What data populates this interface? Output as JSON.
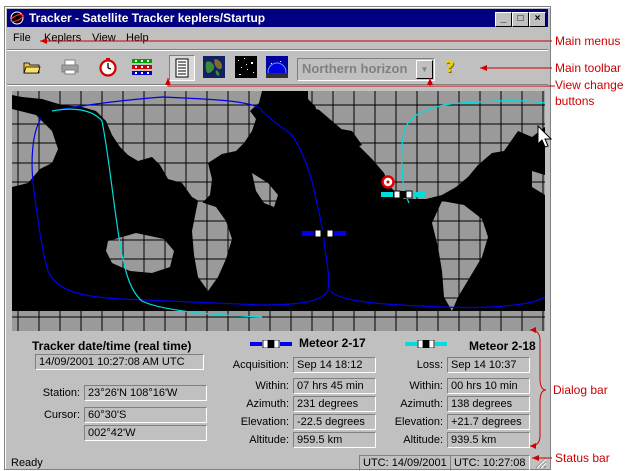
{
  "window": {
    "title": "Tracker - Satellite Tracker  keplers/Startup"
  },
  "menu": [
    "File",
    "Keplers",
    "View",
    "Help"
  ],
  "toolbar": {
    "tools": [
      "open-folder-icon",
      "printer-icon",
      "clock-icon",
      "satellite-list-icon",
      "text-view-icon",
      "globe-view-icon",
      "star-view-icon",
      "horizon-view-icon",
      "help-icon"
    ],
    "view_select": "Northern horizon"
  },
  "dialog": {
    "tracker": {
      "title": "Tracker date/time (real time)",
      "datetime": "14/09/2001 10:27:08 AM UTC",
      "station_label": "Station:",
      "station": "23°26'N   108°16'W",
      "cursor_label": "Cursor:",
      "cursor_lat": "60°30'S",
      "cursor_lon": "002°42'W"
    },
    "sat1": {
      "name": "Meteor 2-17",
      "color": "#0000cc",
      "event_label": "Acquisition:",
      "event": "Sep 14  18:12",
      "within_label": "Within:",
      "within": "07 hrs 45 min",
      "azimuth_label": "Azimuth:",
      "azimuth": "231 degrees",
      "elevation_label": "Elevation:",
      "elevation": "-22.5 degrees",
      "altitude_label": "Altitude:",
      "altitude": "959.5 km"
    },
    "sat2": {
      "name": "Meteor 2-18",
      "color": "#00cccc",
      "event_label": "Loss:",
      "event": "Sep 14  10:37",
      "within_label": "Within:",
      "within": "00 hrs 10 min",
      "azimuth_label": "Azimuth:",
      "azimuth": "138 degrees",
      "elevation_label": "Elevation:",
      "elevation": "+21.7 degrees",
      "altitude_label": "Altitude:",
      "altitude": "939.5 km"
    }
  },
  "status": {
    "ready": "Ready",
    "date": "UTC: 14/09/2001",
    "time": "UTC: 10:27:08"
  },
  "annotations": {
    "main_menus": "Main menus",
    "main_toolbar": "Main toolbar",
    "view_change_1": "View change",
    "view_change_2": "buttons",
    "dialog_bar": "Dialog bar",
    "status_bar": "Status bar"
  }
}
